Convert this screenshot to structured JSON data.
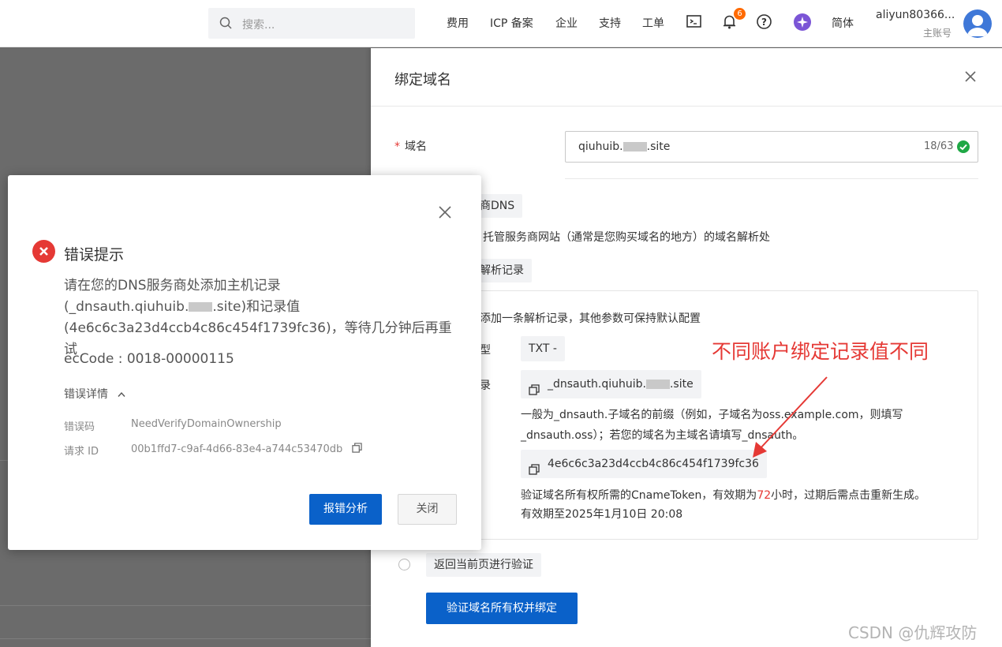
{
  "topbar": {
    "search_placeholder": "搜索...",
    "nav": [
      "费用",
      "ICP 备案",
      "企业",
      "支持",
      "工单"
    ],
    "notification_count": "6",
    "language": "简体",
    "user_name": "aliyun80366...",
    "user_sub": "主账号"
  },
  "drawer": {
    "title": "绑定域名",
    "domain_label": "域名",
    "domain_value_prefix": "qiuhuib.",
    "domain_value_suffix": ".site",
    "domain_count": "18/63",
    "tag_dns": "商DNS",
    "dns_hint": "名托管服务商网站（通常是您购买域名的地方）的域名解析处",
    "tag_record": "解析记录",
    "add_record_hint": "添加一条解析记录，其他参数可保持默认配置",
    "type_label": "型",
    "type_value": "TXT -",
    "host_label": "录",
    "host_value_prefix": "_dnsauth.qiuhuib.",
    "host_value_suffix": ".site",
    "prefix_note_1": "一般为_dnsauth.子域名的前缀（例如，子域名为oss.example.com，则填写",
    "prefix_note_2": "_dnsauth.oss）；若您的域名为主域名请填写_dnsauth。",
    "record_value": "4e6c6c3a23d4ccb4c86c454f1739fc36",
    "token_note_prefix": "验证域名所有权所需的CnameToken，有效期为",
    "token_hours": "72",
    "token_note_suffix": "小时，过期后需点击重新生成。",
    "token_expire": "有效期至2025年1月10日 20:08",
    "radio_label": "返回当前页进行验证",
    "verify_button": "验证域名所有权并绑定"
  },
  "annotation": "不同账户绑定记录值不同",
  "watermark": "CSDN @仇辉攻防",
  "modal": {
    "title": "错误提示",
    "msg_line1": "请在您的DNS服务商处添加主机记录",
    "msg_line2_prefix": "(_dnsauth.qiuhuib.",
    "msg_line2_suffix": ".site)和记录值",
    "msg_line3": "(4e6c6c3a23d4ccb4c86c454f1739fc36)，等待几分钟后再重试",
    "ec_code": "ecCode : 0018-00000115",
    "detail_toggle": "错误详情",
    "error_code_label": "错误码",
    "error_code_value": "NeedVerifyDomainOwnership",
    "request_id_label": "请求 ID",
    "request_id_value": "00b1ffd7-c9af-4d66-83e4-a744c53470db",
    "report_button": "报错分析",
    "close_button": "关闭"
  },
  "colors": {
    "primary": "#0a61c9",
    "error": "#e53935",
    "success": "#1fa845",
    "badge": "#ff6a00"
  }
}
